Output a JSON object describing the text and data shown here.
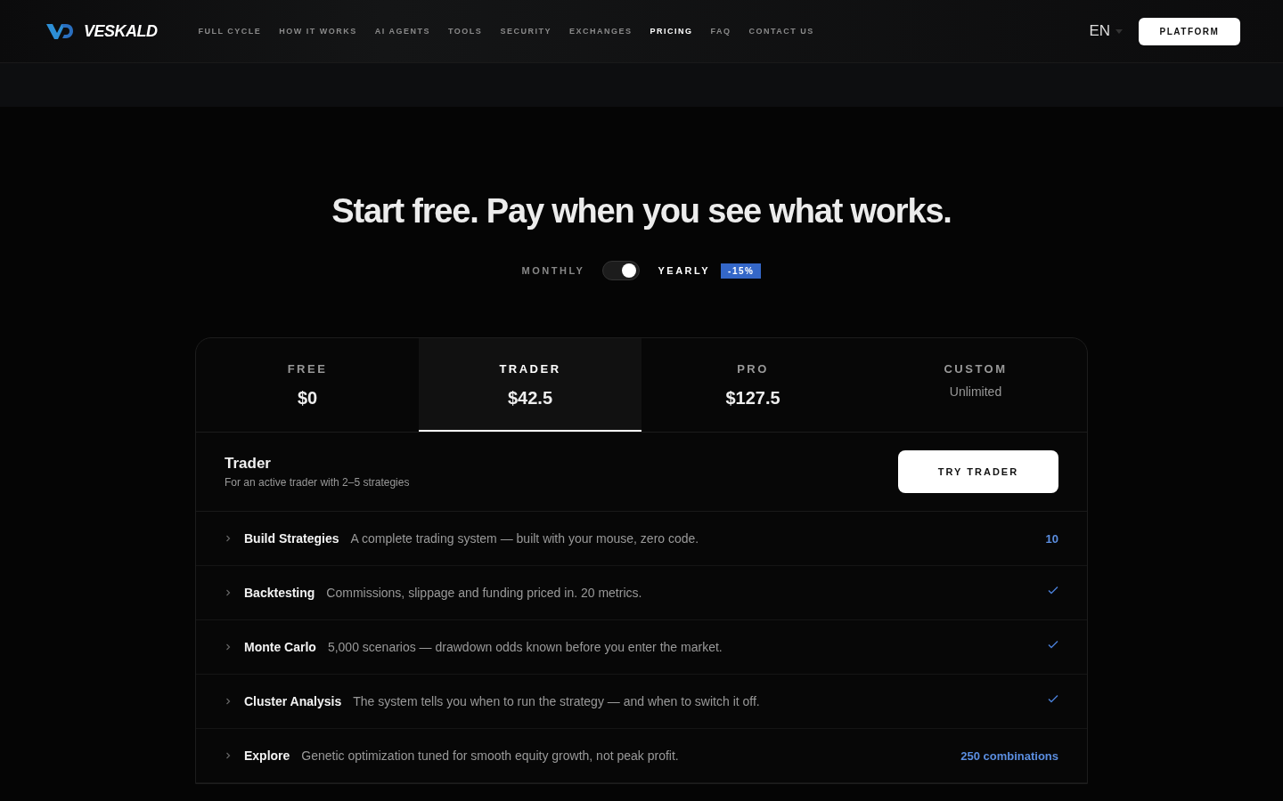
{
  "brand": {
    "name": "VESKALD"
  },
  "nav": [
    {
      "label": "FULL CYCLE",
      "selected": false
    },
    {
      "label": "HOW IT WORKS",
      "selected": false
    },
    {
      "label": "AI AGENTS",
      "selected": false
    },
    {
      "label": "TOOLS",
      "selected": false
    },
    {
      "label": "SECURITY",
      "selected": false
    },
    {
      "label": "EXCHANGES",
      "selected": false
    },
    {
      "label": "PRICING",
      "selected": true
    },
    {
      "label": "FAQ",
      "selected": false
    },
    {
      "label": "CONTACT US",
      "selected": false
    }
  ],
  "language": "EN",
  "platform_button": "PLATFORM",
  "heading": "Start free. Pay when you see what works.",
  "billing": {
    "monthly": "MONTHLY",
    "yearly": "YEARLY",
    "yearly_on": true,
    "discount": "-15%"
  },
  "plans": [
    {
      "name": "FREE",
      "price": "$0",
      "kind": "price",
      "selected": false
    },
    {
      "name": "TRADER",
      "price": "$42.5",
      "kind": "price",
      "selected": true
    },
    {
      "name": "PRO",
      "price": "$127.5",
      "kind": "price",
      "selected": false
    },
    {
      "name": "CUSTOM",
      "price": "Unlimited",
      "kind": "note",
      "selected": false
    }
  ],
  "plan_detail": {
    "title": "Trader",
    "subtitle": "For an active trader with 2–5 strategies",
    "button": "TRY TRADER"
  },
  "features": [
    {
      "name": "Build Strategies",
      "description": "A complete trading system — built with your mouse, zero code.",
      "kind": "value",
      "value": "10"
    },
    {
      "name": "Backtesting",
      "description": "Commissions, slippage and funding priced in. 20 metrics.",
      "kind": "check"
    },
    {
      "name": "Monte Carlo",
      "description": "5,000 scenarios — drawdown odds known before you enter the market.",
      "kind": "check"
    },
    {
      "name": "Cluster Analysis",
      "description": "The system tells you when to run the strategy — and when to switch it off.",
      "kind": "check"
    },
    {
      "name": "Explore",
      "description": "Genetic optimization tuned for smooth equity growth, not peak profit.",
      "kind": "value",
      "value": "250 combinations"
    }
  ]
}
